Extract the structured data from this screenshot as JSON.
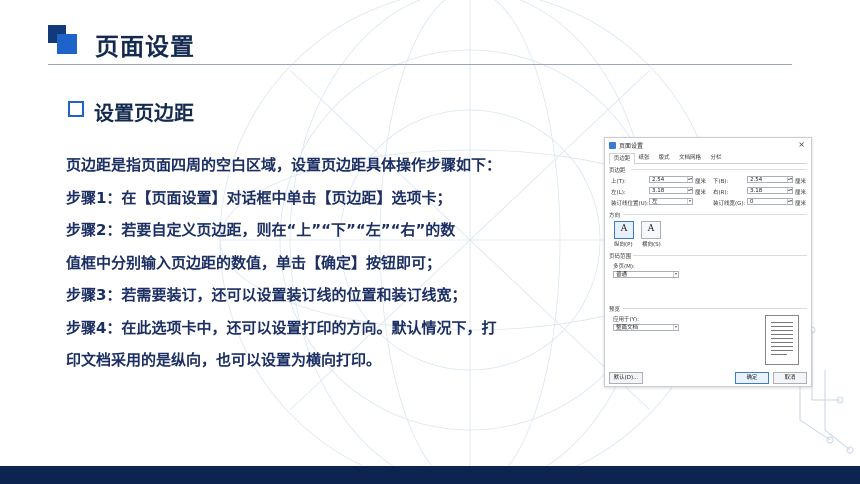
{
  "header": {
    "title": "页面设置"
  },
  "section": {
    "title": "设置页边距"
  },
  "paragraphs": [
    "页边距是指页面四周的空白区域，设置页边距具体操作步骤如下：",
    "步骤1：在【页面设置】对话框中单击【页边距】选项卡；",
    "步骤2：若要自定义页边距，则在“上”“下”“左”“右”的数",
    "值框中分别输入页边距的数值，单击【确定】按钮即可；",
    "步骤3：若需要装订，还可以设置装订线的位置和装订线宽；",
    "步骤4：在此选项卡中，还可以设置打印的方向。默认情况下，打",
    "印文档采用的是纵向，也可以设置为横向打印。"
  ],
  "dialog": {
    "title": "页面设置",
    "close": "×",
    "tabs": [
      "页边距",
      "纸张",
      "版式",
      "文档网格",
      "分栏"
    ],
    "margins_group": "页边距",
    "top_label": "上(T):",
    "top_value": "2.54",
    "top_unit": "厘米",
    "bottom_label": "下(B):",
    "bottom_value": "2.54",
    "bottom_unit": "厘米",
    "left_label": "左(L):",
    "left_value": "3.18",
    "left_unit": "厘米",
    "right_label": "右(R):",
    "right_value": "3.18",
    "right_unit": "厘米",
    "gutter_pos_label": "装订线位置(U):",
    "gutter_pos_value": "左",
    "gutter_width_label": "装订线宽(G):",
    "gutter_width_value": "0",
    "gutter_width_unit": "厘米",
    "orientation_group": "方向",
    "portrait_label": "纵向(P)",
    "landscape_label": "横向(S)",
    "orientation_icon": "A",
    "pages_group": "页码范围",
    "multi_pages_label": "多页(M):",
    "multi_pages_value": "普通",
    "preview_group": "预览",
    "apply_to_label": "应用于(Y):",
    "apply_to_value": "整篇文档",
    "default_button": "默认(D)...",
    "ok_button": "确定",
    "cancel_button": "取消"
  }
}
